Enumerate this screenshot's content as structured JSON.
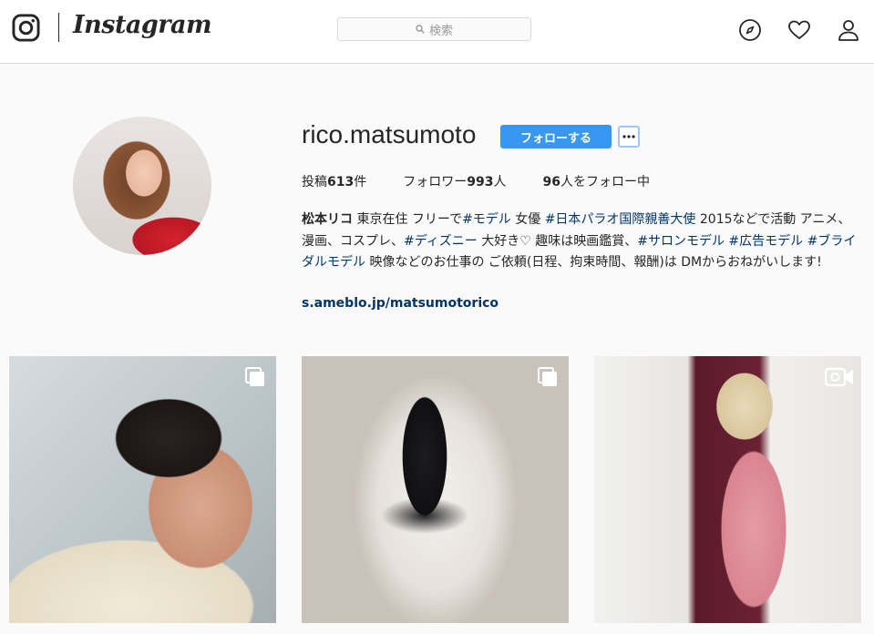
{
  "header": {
    "logo_text": "Instagram",
    "search_placeholder": "検索",
    "nav_icons": [
      "compass-icon",
      "heart-icon",
      "person-icon"
    ]
  },
  "profile": {
    "username": "rico.matsumoto",
    "follow_label": "フォローする",
    "more_label": "•••",
    "stats": {
      "posts_prefix": "投稿",
      "posts_count": "613",
      "posts_suffix": "件",
      "followers_prefix": "フォロワー",
      "followers_count": "993",
      "followers_suffix": "人",
      "following_count": "96",
      "following_suffix": "人をフォロー中"
    },
    "bio": {
      "name": "松本リコ",
      "t1": " 東京在住 フリーで",
      "tag1": "#モデル",
      "t2": " 女優 ",
      "tag2": "#日本パラオ国際親善大使",
      "t3": " 2015などで活動 アニメ、漫画、コスプレ、",
      "tag3": "#ディズニー",
      "t4": " 大好き♡ 趣味は映画鑑賞、",
      "tag4": "#サロンモデル",
      "t5": " ",
      "tag5": "#広告モデル",
      "t6": " ",
      "tag6": "#ブライダルモデル",
      "t7": " 映像などのお仕事の ご依頼(日程、拘束時間、報酬)は DMからおねがいします!"
    },
    "link": "s.ameblo.jp/matsumotorico"
  },
  "posts": [
    {
      "type": "carousel",
      "badge_icon": "multiple-photos-icon"
    },
    {
      "type": "carousel",
      "badge_icon": "multiple-photos-icon"
    },
    {
      "type": "video",
      "badge_icon": "video-icon"
    }
  ],
  "colors": {
    "accent": "#3897f0",
    "link": "#003569",
    "border": "#dbdbdb",
    "background": "#fafafa"
  }
}
